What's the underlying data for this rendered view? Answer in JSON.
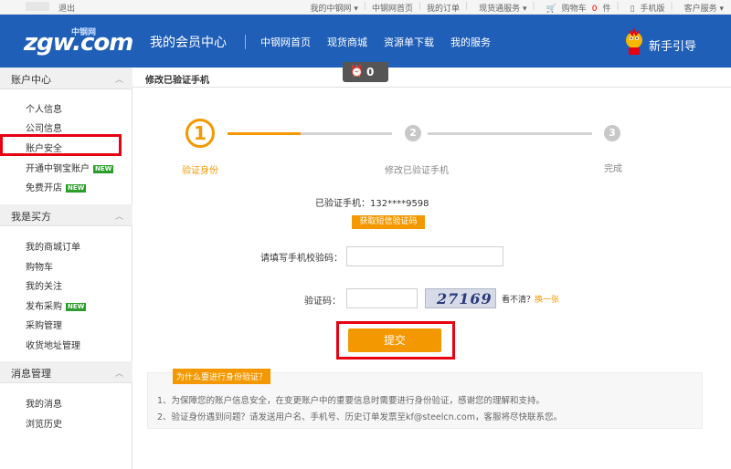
{
  "topbar": {
    "logout": "退出",
    "links": [
      "我的中钢网",
      "中钢网首页",
      "我的订单",
      "现货通服务"
    ],
    "cart_label": "购物车",
    "cart_count": "0",
    "cart_unit": "件",
    "mobile": "手机版",
    "service": "客户服务"
  },
  "header": {
    "logo_text": "zgw.com",
    "logo_small": "中钢网",
    "title": "我的会员中心",
    "nav": [
      "中钢网首页",
      "现货商城",
      "资源单下载",
      "我的服务"
    ],
    "guide": "新手引导"
  },
  "sidebar": {
    "sections": [
      {
        "title": "账户中心",
        "items": [
          "个人信息",
          "公司信息",
          "账户安全",
          "开通中钢宝账户",
          "免费开店"
        ]
      },
      {
        "title": "我是买方",
        "items": [
          "我的商城订单",
          "购物车",
          "我的关注",
          "发布采购",
          "采购管理",
          "收货地址管理"
        ]
      },
      {
        "title": "消息管理",
        "items": [
          "我的消息",
          "浏览历史"
        ]
      }
    ],
    "new_badge": "NEW"
  },
  "main": {
    "title": "修改已验证手机",
    "timer_value": "0",
    "steps": [
      {
        "num": "1",
        "label": "验证身份"
      },
      {
        "num": "2",
        "label": "修改已验证手机"
      },
      {
        "num": "3",
        "label": "完成"
      }
    ],
    "verified_phone_label": "已验证手机：",
    "verified_phone": "132****9598",
    "sms_button": "获取短信验证码",
    "sms_code_label": "请填写手机校验码：",
    "captcha_label": "验证码：",
    "captcha_text": "27169",
    "captcha_unclear": "看不清？",
    "captcha_refresh": "换一张",
    "submit": "提交",
    "notice_tag": "为什么要进行身份验证？",
    "notice_lines": [
      "1、为保障您的账户信息安全，在变更账户中的重要信息时需要进行身份验证，感谢您的理解和支持。",
      "2、验证身份遇到问题？请发送用户名、手机号、历史订单发票至kf@steelcn.com，客服将尽快联系您。"
    ]
  },
  "colors": {
    "brand_blue": "#1f5fb8",
    "accent_orange": "#f39800",
    "highlight_red": "#e60012"
  }
}
